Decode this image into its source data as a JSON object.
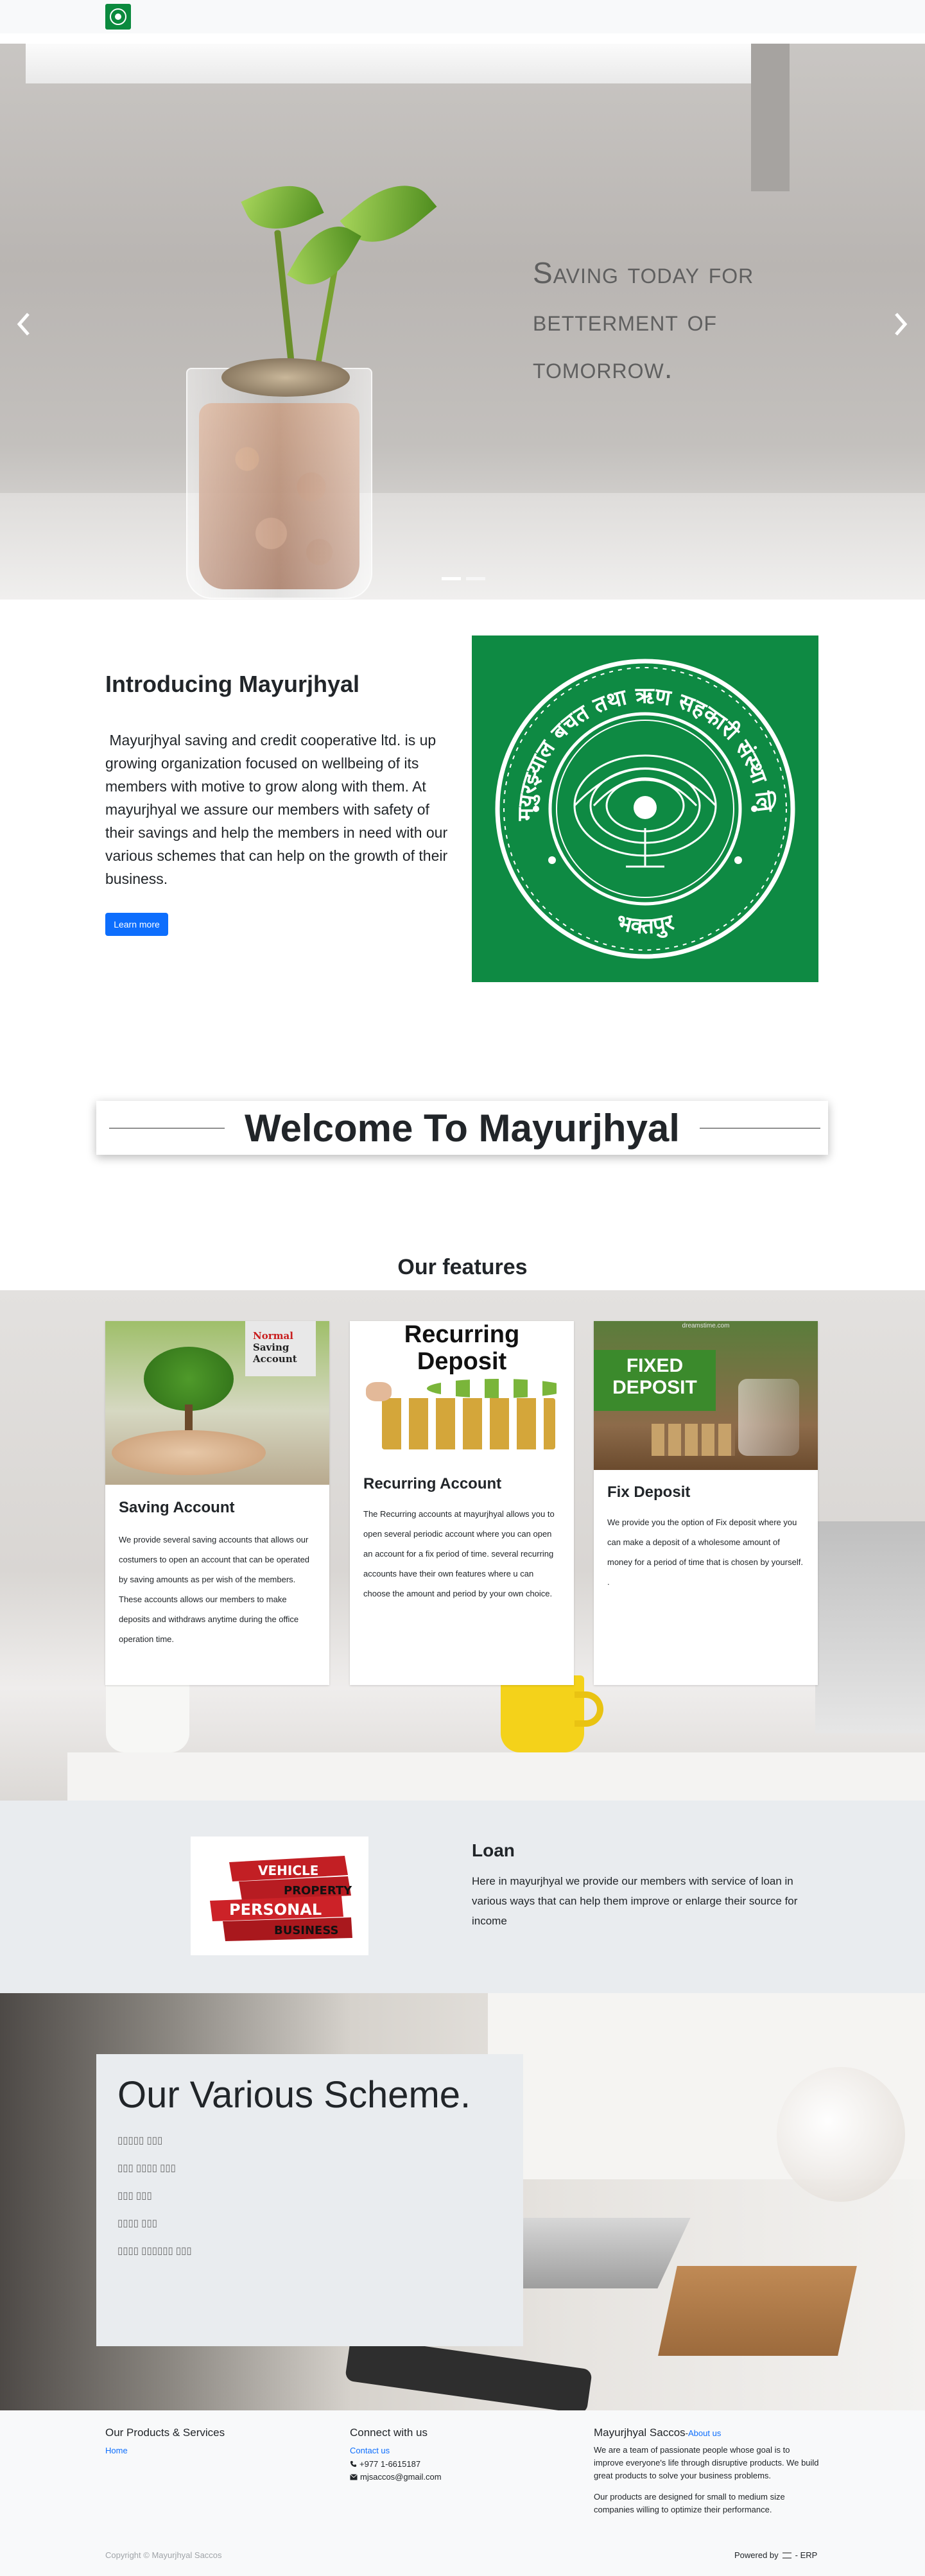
{
  "hero": {
    "caption": "Saving today for betterment of tomorrow.",
    "prev_icon": "chevron-left-icon",
    "next_icon": "chevron-right-icon",
    "slides": 2,
    "active_slide": 1
  },
  "intro": {
    "title": "Introducing Mayurjhyal",
    "text": " Mayurjhyal saving and credit cooperative ltd. is up growing organization focused on wellbeing of its members with motive to grow along with them. At mayurjhyal we assure our members with safety of their savings and help the members in need with our various schemes that can help on the growth of their business.",
    "button_label": "Learn more",
    "seal": {
      "top_text": "मयुरझ्याल बचत तथा ऋण सहकारी संस्था लि.",
      "bottom_text": "भक्तपुर"
    }
  },
  "welcome": {
    "title": "Welcome To Mayurjhyal"
  },
  "features": {
    "title": "Our features",
    "cards": [
      {
        "image_label_lines": [
          "Normal",
          "Saving",
          "Account"
        ],
        "title": "Saving Account",
        "text": "We provide several saving accounts that allows our costumers to open an account that can be operated by saving amounts as per wish of the members. These accounts allows our members to make deposits and withdraws anytime during the office operation time."
      },
      {
        "image_label_lines": [
          "Recurring",
          "Deposit"
        ],
        "title": "Recurring Account",
        "text": "The Recurring accounts at mayurjhyal allows you to open several periodic account where you can open an account for a fix period of time. several recurring accounts have their own features where u can choose the amount and period by your own choice."
      },
      {
        "image_label_lines": [
          "FIXED",
          "DEPOSIT"
        ],
        "image_watermark": "dreamstime.com",
        "title": "Fix Deposit",
        "text": "We provide you the option of Fix deposit where you can make a deposit of a wholesome amount of money for a period of time that is chosen by yourself.\n."
      }
    ]
  },
  "loan": {
    "image_words": [
      "VEHICLE",
      "PROPERTY",
      "PERSONAL",
      "BUSINESS"
    ],
    "title": "Loan",
    "text": "Here in mayurjhyal we provide our members with service of loan in various ways that can help them improve or enlarge their source for income"
  },
  "scheme": {
    "title": "Our Various  Scheme.",
    "items": [
      "▯▯▯▯▯ ▯▯▯",
      "▯▯▯ ▯▯▯▯ ▯▯▯",
      "▯▯▯ ▯▯▯",
      "▯▯▯▯ ▯▯▯",
      "▯▯▯▯ ▯▯▯▯▯▯ ▯▯▯"
    ]
  },
  "footer": {
    "col1_title": "Our Products & Services",
    "col1_link": "Home",
    "col2_title": "Connect with us",
    "contact_link": "Contact us",
    "phone": "+977 1-6615187",
    "email": "mjsaccos@gmail.com",
    "phone_icon": "phone-icon",
    "email_icon": "envelope-icon",
    "col3_title": "Mayurjhyal Saccos",
    "about_link": "About us",
    "about_sep": " - ",
    "para1": "We are a team of passionate people whose goal is to improve everyone's life through disruptive products. We build great products to solve your business problems.",
    "para2": "Our products are designed for small to medium size companies willing to optimize their performance.",
    "copyright": "Copyright © Mayurjhyal Saccos",
    "powered_prefix": "Powered by",
    "powered_suffix": "- ERP"
  },
  "colors": {
    "brand_green": "#0e8a43",
    "primary": "#0d6efd",
    "light_bg": "#e9ecef"
  }
}
